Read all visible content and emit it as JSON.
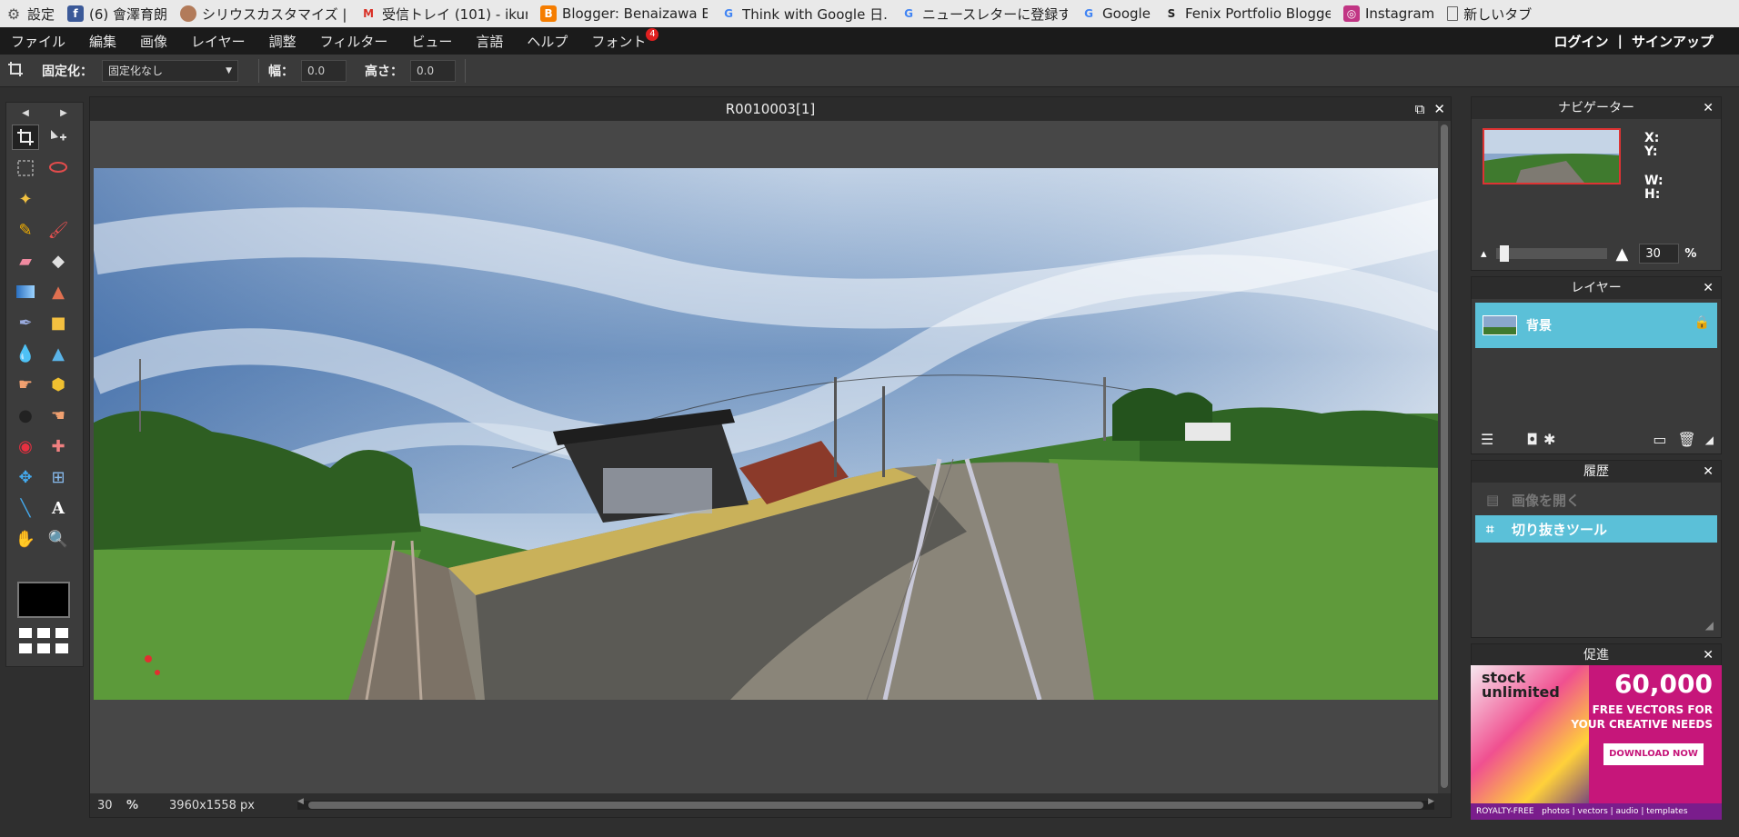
{
  "bookmarks": [
    {
      "icon": "gear-icon",
      "label": "設定"
    },
    {
      "icon": "facebook-icon",
      "label": "(6) 會澤育朗"
    },
    {
      "icon": "avatar-icon",
      "label": "シリウスカスタマイズ | オ..."
    },
    {
      "icon": "gmail-icon",
      "label": "受信トレイ (101) - ikun..."
    },
    {
      "icon": "blogger-icon",
      "label": "Blogger: Benaizawa B..."
    },
    {
      "icon": "google-icon",
      "label": "Think with Google 日..."
    },
    {
      "icon": "google-icon",
      "label": "ニュースレターに登録する..."
    },
    {
      "icon": "google-icon",
      "label": "Google"
    },
    {
      "icon": "s-icon",
      "label": "Fenix Portfolio Blogge..."
    },
    {
      "icon": "instagram-icon",
      "label": "Instagram"
    },
    {
      "icon": "page-icon",
      "label": "新しいタブ"
    }
  ],
  "menu": [
    "ファイル",
    "編集",
    "画像",
    "レイヤー",
    "調整",
    "フィルター",
    "ビュー",
    "言語",
    "ヘルプ",
    "フォント"
  ],
  "font_badge": "4",
  "auth": {
    "login": "ログイン",
    "sep": "|",
    "signup": "サインアップ"
  },
  "options": {
    "fix_label": "固定化：",
    "fix_value": "固定化なし",
    "width_label": "幅：",
    "width_value": "0.0",
    "height_label": "高さ：",
    "height_value": "0.0"
  },
  "document": {
    "title": "R0010003[1]",
    "zoom": "30",
    "zoom_unit": "%",
    "size": "3960x1558 px"
  },
  "navigator": {
    "title": "ナビゲーター",
    "x": "X:",
    "y": "Y:",
    "w": "W:",
    "h": "H:",
    "zoom": "30",
    "unit": "%"
  },
  "layers": {
    "title": "レイヤー",
    "items": [
      {
        "name": "背景"
      }
    ]
  },
  "history": {
    "title": "履歴",
    "items": [
      "画像を開く",
      "切り抜きツール"
    ]
  },
  "promo": {
    "title": "促進",
    "brand": "stock unlimited",
    "headline": "60,000",
    "sub1": "FREE VECTORS FOR",
    "sub2": "YOUR CREATIVE NEEDS",
    "cta": "DOWNLOAD NOW",
    "footer": "ROYALTY-FREE   photos | vectors | audio | templates"
  },
  "colors": {
    "accent": "#5bc0d8",
    "menubar": "#1b1b1b",
    "panel": "#3a3a3a"
  }
}
